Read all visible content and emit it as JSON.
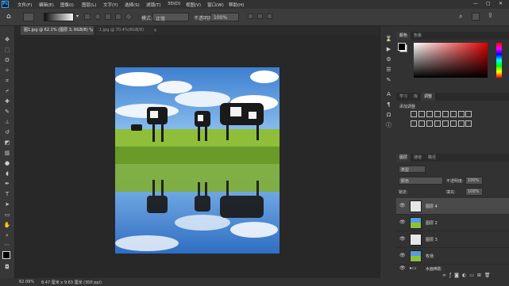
{
  "app": {
    "logo": "Ps"
  },
  "menu": [
    "文件(F)",
    "编辑(E)",
    "图像(I)",
    "图层(L)",
    "文字(Y)",
    "选择(S)",
    "滤镜(T)",
    "3D(D)",
    "视图(V)",
    "窗口(W)",
    "帮助(H)"
  ],
  "window_controls": {
    "minimize": "—",
    "maximize": "▢",
    "close": "✕"
  },
  "options": {
    "mode_label": "模式:",
    "mode_value": "正常",
    "opacity_label": "不透明度:",
    "opacity_value": "100%"
  },
  "tabs": [
    {
      "label": "图1.jpg @ 62.1% (图层 3, RGB/8) *",
      "close": "×",
      "active": true
    },
    {
      "label": "1.jpg @ 70.4%(RGB/8)",
      "close": "×",
      "active": false
    }
  ],
  "status": {
    "zoom": "62.09%",
    "size": "8.47 厘米 x 9.63 厘米 (300 ppi)"
  },
  "color_panel": {
    "tabs": [
      "颜色",
      "色板"
    ]
  },
  "adjust_panel": {
    "tabs": [
      "学习",
      "库",
      "调整"
    ],
    "heading": "添加调整"
  },
  "layers_panel": {
    "tabs": [
      "图层",
      "通道",
      "路径"
    ],
    "kind_label": "类型",
    "blend_mode": "颜色",
    "opacity_label": "不透明度:",
    "opacity_value": "100%",
    "lock_label": "锁定:",
    "fill_label": "填充:",
    "fill_value": "100%",
    "layers": [
      {
        "name": "图层 4",
        "selected": true
      },
      {
        "name": "图层 2",
        "selected": false
      },
      {
        "name": "图层 3",
        "selected": false
      },
      {
        "name": "牧场",
        "selected": false
      },
      {
        "name": "水面倒影",
        "selected": false
      }
    ]
  },
  "colors": {
    "accent": "#31a8ff",
    "panel": "#323232",
    "canvas": "#282828"
  }
}
